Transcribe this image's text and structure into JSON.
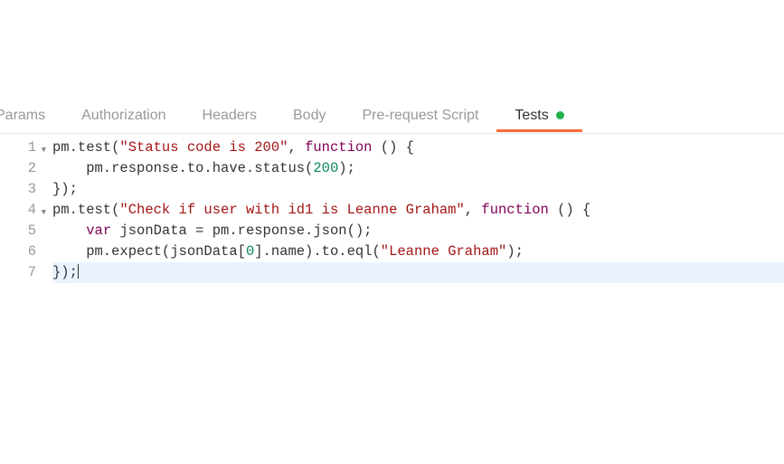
{
  "tabs": {
    "params": "Params",
    "authorization": "Authorization",
    "headers": "Headers",
    "body": "Body",
    "prerequest": "Pre-request Script",
    "tests": "Tests"
  },
  "gutter": {
    "l1": "1",
    "l2": "2",
    "l3": "3",
    "l4": "4",
    "l5": "5",
    "l6": "6",
    "l7": "7"
  },
  "code": {
    "l1_a": "pm.test(",
    "l1_b": "\"Status code is 200\"",
    "l1_c": ", ",
    "l1_d": "function",
    "l1_e": " () {",
    "l2_a": "    pm.response.to.have.status(",
    "l2_b": "200",
    "l2_c": ");",
    "l3": "});",
    "l4_a": "pm.test(",
    "l4_b": "\"Check if user with id1 is Leanne Graham\"",
    "l4_c": ", ",
    "l4_d": "function",
    "l4_e": " () {",
    "l5_a": "    ",
    "l5_b": "var",
    "l5_c": " jsonData = pm.response.json();",
    "l6_a": "    pm.expect(jsonData[",
    "l6_b": "0",
    "l6_c": "].name).to.eql(",
    "l6_d": "\"Leanne Graham\"",
    "l6_e": ");",
    "l7": "});"
  }
}
